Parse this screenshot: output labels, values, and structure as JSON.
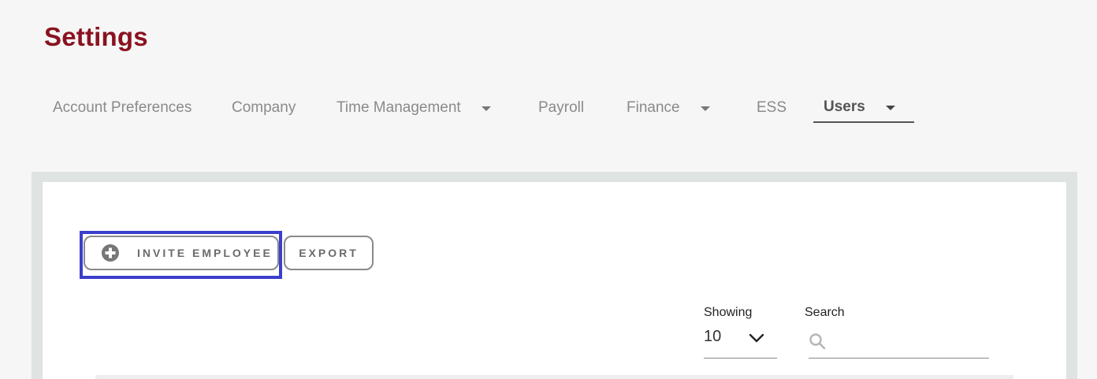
{
  "page": {
    "title": "Settings"
  },
  "tabs": [
    {
      "label": "Account Preferences",
      "has_dropdown": false,
      "active": false
    },
    {
      "label": "Company",
      "has_dropdown": false,
      "active": false
    },
    {
      "label": "Time Management",
      "has_dropdown": true,
      "active": false
    },
    {
      "label": "Payroll",
      "has_dropdown": false,
      "active": false
    },
    {
      "label": "Finance",
      "has_dropdown": true,
      "active": false
    },
    {
      "label": "ESS",
      "has_dropdown": false,
      "active": false
    },
    {
      "label": "Users",
      "has_dropdown": true,
      "active": true
    }
  ],
  "actions": {
    "invite_label": "INVITE EMPLOYEE",
    "invite_icon": "plus-circle-icon",
    "export_label": "EXPORT"
  },
  "table_controls": {
    "showing_label": "Showing",
    "showing_value": "10",
    "search_label": "Search",
    "search_value": "",
    "search_placeholder": ""
  },
  "colors": {
    "title": "#8a1220",
    "highlight": "#3b3fcb",
    "tab_text": "#8a8a8a",
    "tab_active": "#555555"
  }
}
